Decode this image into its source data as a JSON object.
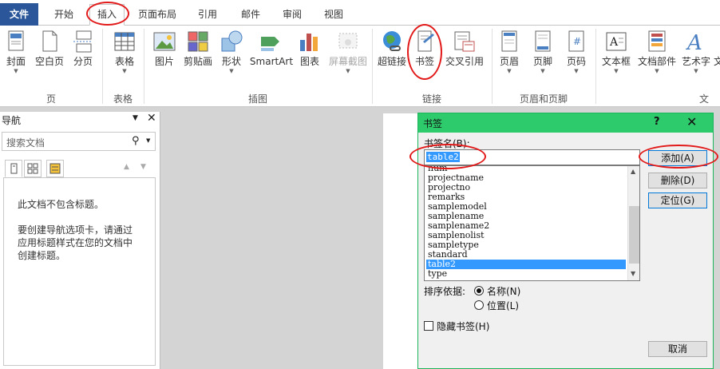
{
  "tabs": {
    "file": "文件",
    "items": [
      "开始",
      "插入",
      "页面布局",
      "引用",
      "邮件",
      "审阅",
      "视图"
    ]
  },
  "ribbon": {
    "buttons": {
      "cover": "封面",
      "blank": "空白页",
      "pagebreak": "分页",
      "table": "表格",
      "picture": "图片",
      "clipart": "剪贴画",
      "shapes": "形状",
      "smartart": "SmartArt",
      "chart": "图表",
      "screenshot": "屏幕截图",
      "hyperlink": "超链接",
      "bookmark": "书签",
      "crossref": "交叉引用",
      "header": "页眉",
      "footer": "页脚",
      "pagenum": "页码",
      "textbox": "文本框",
      "quickparts": "文档部件",
      "wordart": "艺术字",
      "more": "文"
    },
    "groups": {
      "pages": "页",
      "tables": "表格",
      "illustrations": "插图",
      "links": "链接",
      "headerfooter": "页眉和页脚",
      "text": "文"
    }
  },
  "nav": {
    "title": "导航",
    "search_placeholder": "搜索文档",
    "msg1": "此文档不包含标题。",
    "msg2": "要创建导航选项卡，请通过",
    "msg3": "应用标题样式在您的文档中",
    "msg4": "创建标题。"
  },
  "dialog": {
    "title": "书签",
    "help": "?",
    "close": "✕",
    "name_label": "书签名(B):",
    "name_value": "table2",
    "list": [
      "num",
      "projectname",
      "projectno",
      "remarks",
      "samplemodel",
      "samplename",
      "samplename2",
      "samplenolist",
      "sampletype",
      "standard",
      "table2",
      "type"
    ],
    "selected_index": 10,
    "btn_add": "添加(A)",
    "btn_delete": "删除(D)",
    "btn_goto": "定位(G)",
    "sort_label": "排序依据:",
    "sort_name": "名称(N)",
    "sort_location": "位置(L)",
    "hidden_label": "隐藏书签(H)",
    "btn_cancel": "取消"
  }
}
